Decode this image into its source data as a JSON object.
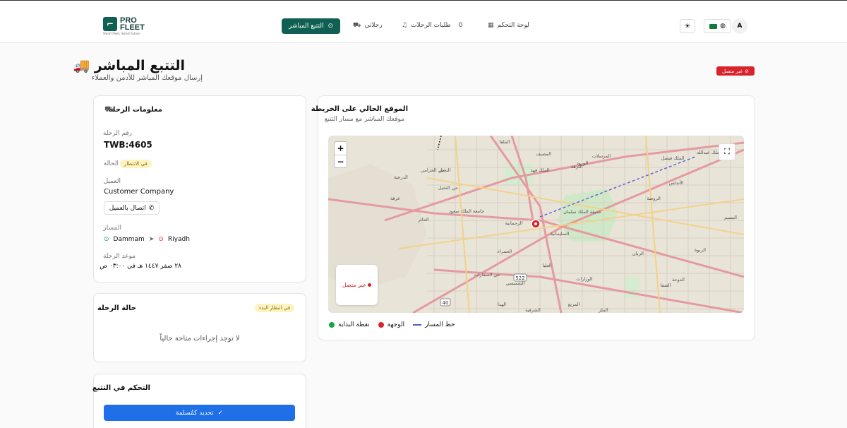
{
  "header": {
    "logo_mark": "⌐",
    "logo_line1": "PRO",
    "logo_line2": "FLEET",
    "logo_tagline": "Smart Fleet, Smart Future",
    "nav": {
      "live_tracking": "التتبع المباشر",
      "my_trips": "رحلاتي",
      "trip_requests": "طلبات الرحلات",
      "trip_requests_count": "0",
      "dashboard": "لوحة التحكم"
    },
    "avatar_initial": "A"
  },
  "page": {
    "title": "التتبع المباشر 🚚",
    "subtitle": "إرسال موقعك المباشر للأدمن والعملاء",
    "connection_badge": "غير متصل"
  },
  "trip_info": {
    "title": "معلومات الرحلة",
    "trip_number_label": "رقم الرحلة",
    "trip_number": "TWB:4605",
    "status_label": "الحالة",
    "status_value": "في الانتظار",
    "client_label": "العميل",
    "client_name": "Customer Company",
    "contact_button": "اتصال بالعميل",
    "route_label": "المسار",
    "origin": "Dammam",
    "destination": "Riyadh",
    "schedule_label": "موعد الرحلة",
    "schedule_value": "٢٨ صفر ١٤٤٧ هـ في ٠٣:٠٠ ص"
  },
  "trip_status": {
    "title": "حالة الرحلة",
    "badge": "في انتظار البدء",
    "empty_text": "لا توجد إجراءات متاحة حالياً"
  },
  "tracking_control": {
    "title": "التحكم في التتبع",
    "primary_button": "تحديد كمُسلمة"
  },
  "map_card": {
    "title": "الموقع الحالي على الخريطة",
    "subtitle": "موقعك المباشر مع مسار التتبع",
    "zoom_in": "+",
    "zoom_out": "−",
    "status_text": "غير متصل",
    "legend": {
      "start": "نقطة البداية",
      "destination": "الوجهة",
      "route": "خط المسار"
    },
    "places": [
      "الملقا",
      "المصيف",
      "النخيل",
      "الملك فهد",
      "الورود",
      "المرسلات",
      "النزهة",
      "الملك فيصل",
      "الحمراء",
      "الدرعية",
      "حي الخزامى",
      "العليا",
      "الروضة",
      "السليمانية",
      "الملز",
      "الريان",
      "الوزارات",
      "الدوحة",
      "حي السفارات",
      "الأندلس",
      "الحائر",
      "الشميسي",
      "المربع",
      "الملك عبدالله",
      "الرحمانية",
      "عرقة",
      "حي النخيل",
      "الهدا",
      "النسيم",
      "الصفا",
      "الربوة",
      "جامعة الملك سعود",
      "حديقة الملك سلمان",
      "الشرقية"
    ],
    "road_shields": [
      "522",
      "40"
    ]
  },
  "colors": {
    "brand": "#0f5f52",
    "danger": "#d8232a",
    "primary": "#1e6fe8",
    "start": "#17a34a",
    "route": "#4f5bd5"
  }
}
